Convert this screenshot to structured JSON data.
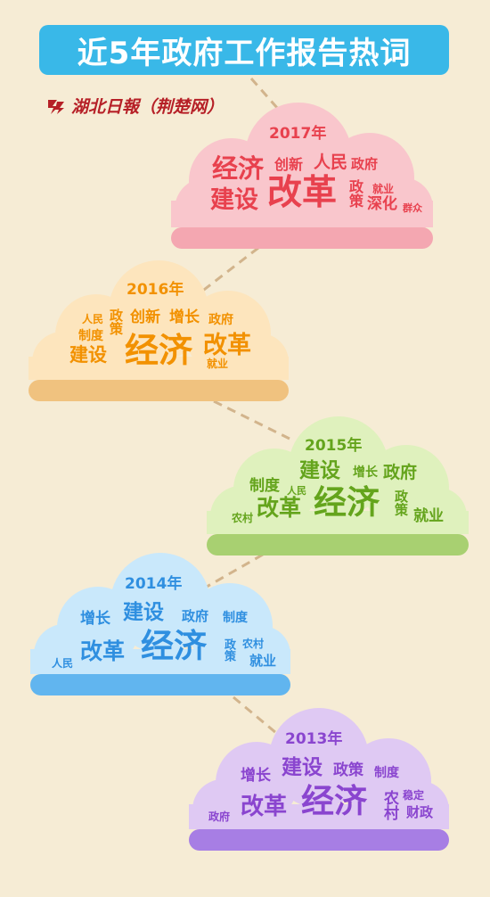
{
  "title": "近5年政府工作报告热词",
  "brand": "湖北日報（荆楚网）",
  "colors": {
    "background": "#f6ecd5",
    "title_bg": "#39b8e8",
    "connector": "#d2b48c",
    "c2017": "#e8414e",
    "c2016": "#f29100",
    "c2015": "#64a41c",
    "c2014": "#2f8fe0",
    "c2013": "#8a45cf"
  },
  "clouds": [
    {
      "year": "2017年",
      "words": [
        "经济",
        "创新",
        "人民",
        "政府",
        "建设",
        "改革",
        "政策",
        "就业",
        "深化",
        "群众"
      ]
    },
    {
      "year": "2016年",
      "words": [
        "人民",
        "政策",
        "创新",
        "增长",
        "政府",
        "制度",
        "建设",
        "经济",
        "改革",
        "就业"
      ]
    },
    {
      "year": "2015年",
      "words": [
        "建设",
        "增长",
        "政府",
        "制度",
        "人民",
        "改革",
        "经济",
        "政策",
        "农村",
        "就业"
      ]
    },
    {
      "year": "2014年",
      "words": [
        "增长",
        "建设",
        "政府",
        "制度",
        "改革",
        "经济",
        "政策",
        "农村",
        "人民",
        "就业"
      ]
    },
    {
      "year": "2013年",
      "words": [
        "建设",
        "增长",
        "政策",
        "制度",
        "改革",
        "经济",
        "农村",
        "稳定",
        "政府",
        "财政"
      ]
    }
  ]
}
